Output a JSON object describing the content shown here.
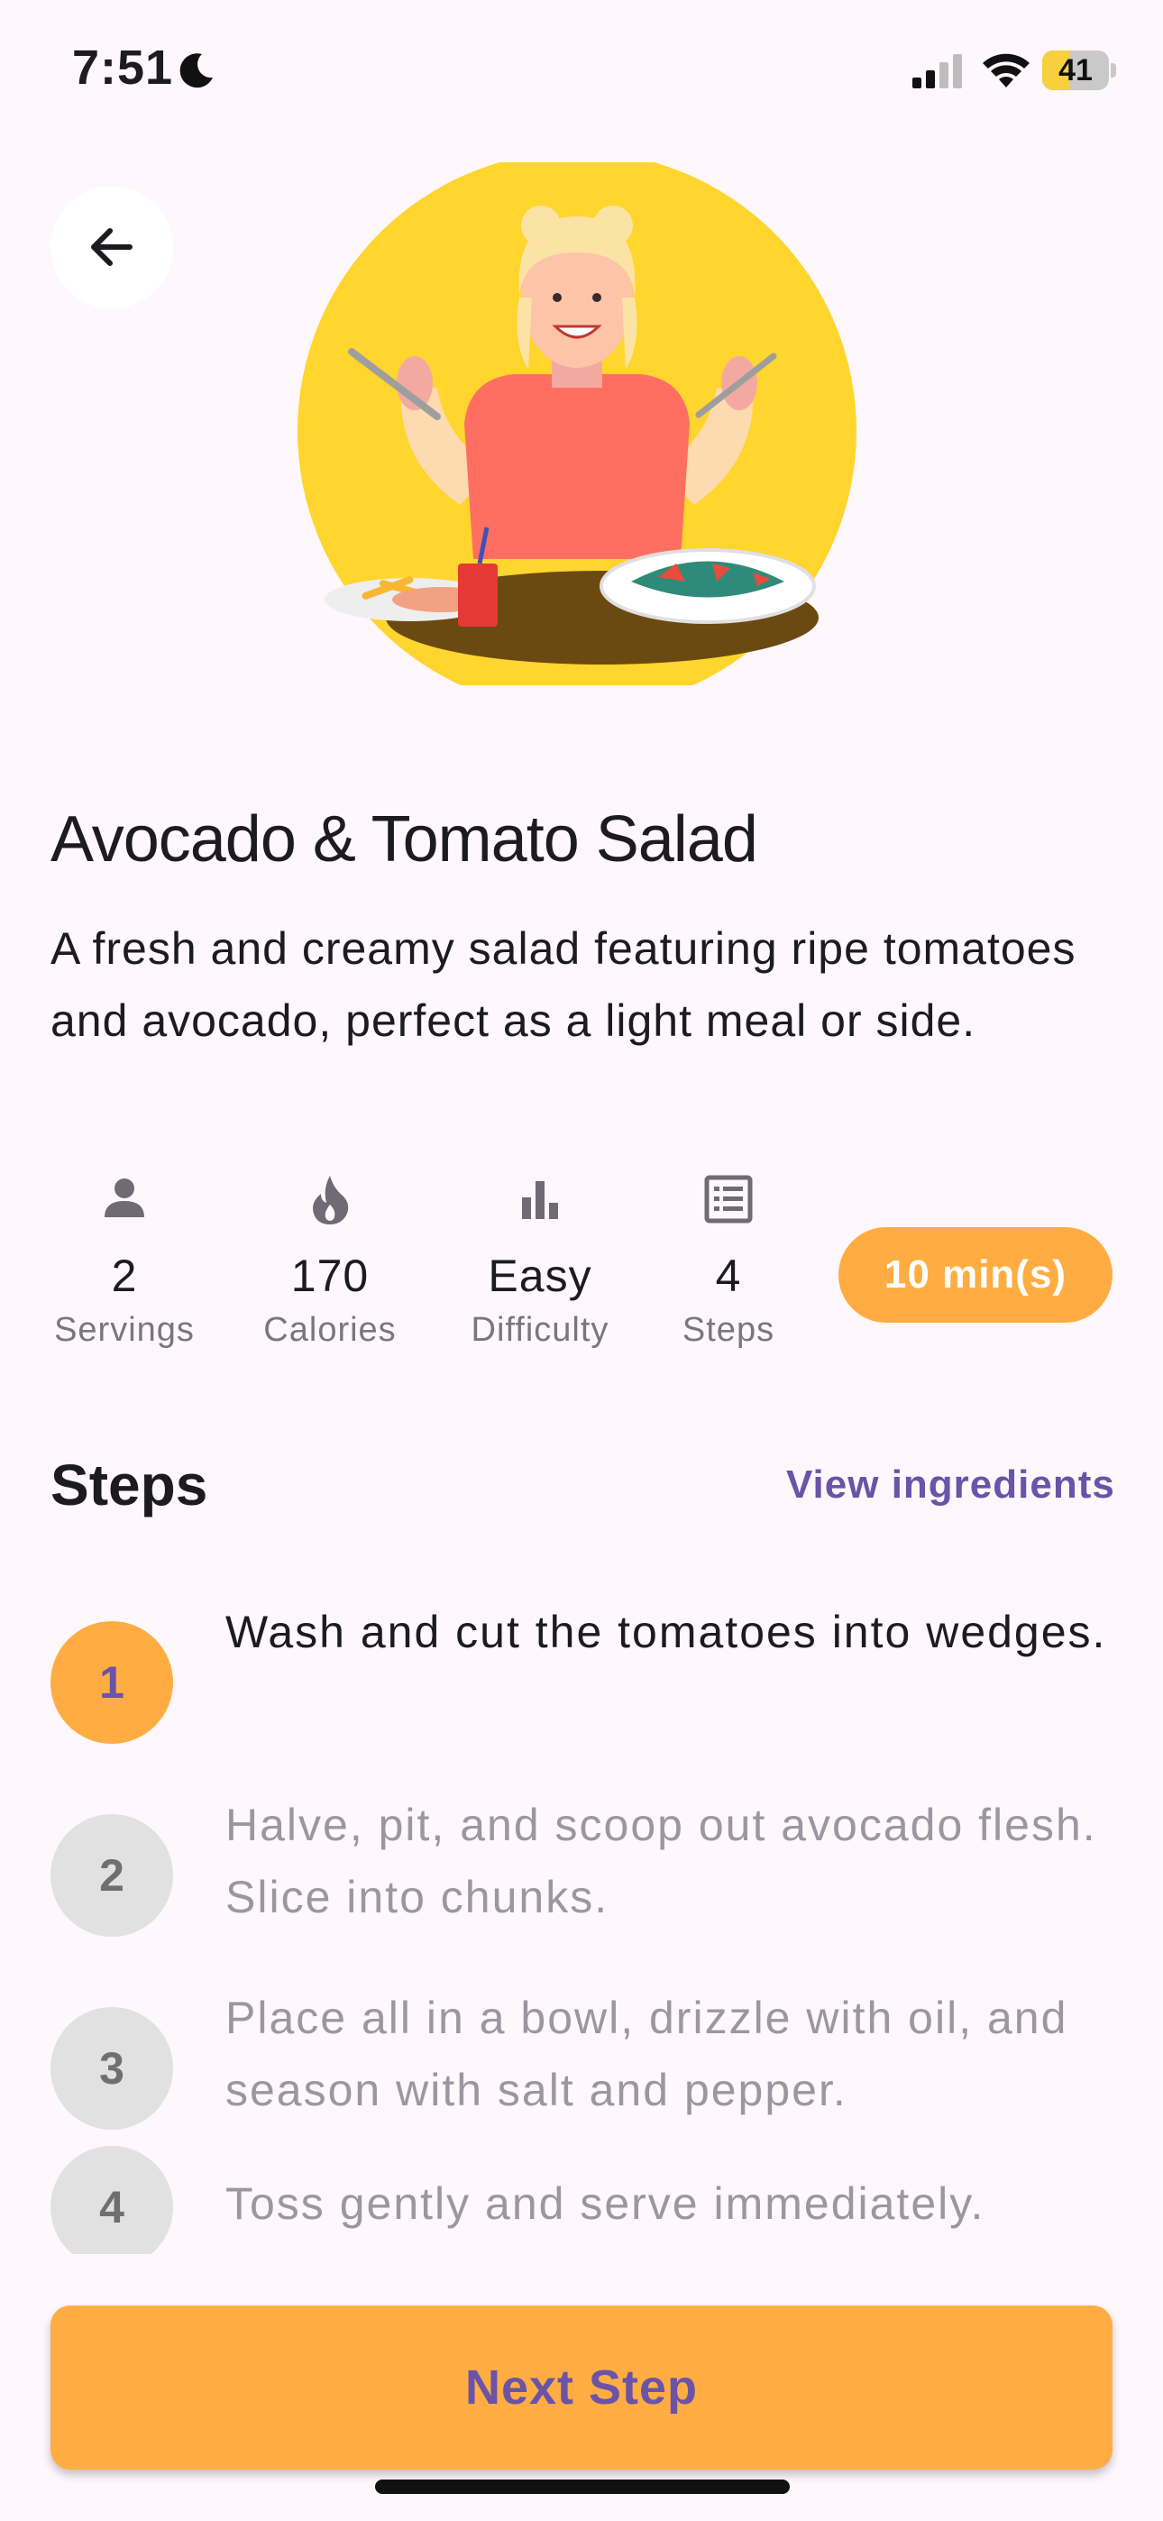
{
  "status_bar": {
    "time": "7:51",
    "battery_level": "41",
    "battery_fraction": 0.41,
    "icons": [
      "moon-icon",
      "signal-icon",
      "wifi-icon",
      "battery-icon"
    ]
  },
  "header": {
    "back_icon": "arrow-left-icon"
  },
  "recipe": {
    "title": "Avocado & Tomato Salad",
    "description": "A fresh and creamy salad featuring ripe tomatoes and avocado, perfect as a light meal or side."
  },
  "stats": [
    {
      "icon": "person-icon",
      "value": "2",
      "label": "Servings"
    },
    {
      "icon": "flame-icon",
      "value": "170",
      "label": "Calories"
    },
    {
      "icon": "bar-chart-icon",
      "value": "Easy",
      "label": "Difficulty"
    },
    {
      "icon": "list-icon",
      "value": "4",
      "label": "Steps"
    }
  ],
  "time_badge": "10 min(s)",
  "steps_section": {
    "heading": "Steps",
    "view_ingredients_label": "View ingredients",
    "steps": [
      {
        "number": "1",
        "text": "Wash and cut the tomatoes into wedges.",
        "active": true
      },
      {
        "number": "2",
        "text": "Halve, pit, and scoop out avocado flesh. Slice into chunks.",
        "active": false
      },
      {
        "number": "3",
        "text": "Place all in a bowl, drizzle with oil, and season with salt and pepper.",
        "active": false
      },
      {
        "number": "4",
        "text": "Toss gently and serve immediately.",
        "active": false
      }
    ]
  },
  "footer": {
    "next_step_label": "Next Step"
  },
  "colors": {
    "background": "#FEF7FC",
    "accent_orange": "#FFAD42",
    "accent_purple": "#6A53A8",
    "hero_circle": "#FFD52E"
  }
}
